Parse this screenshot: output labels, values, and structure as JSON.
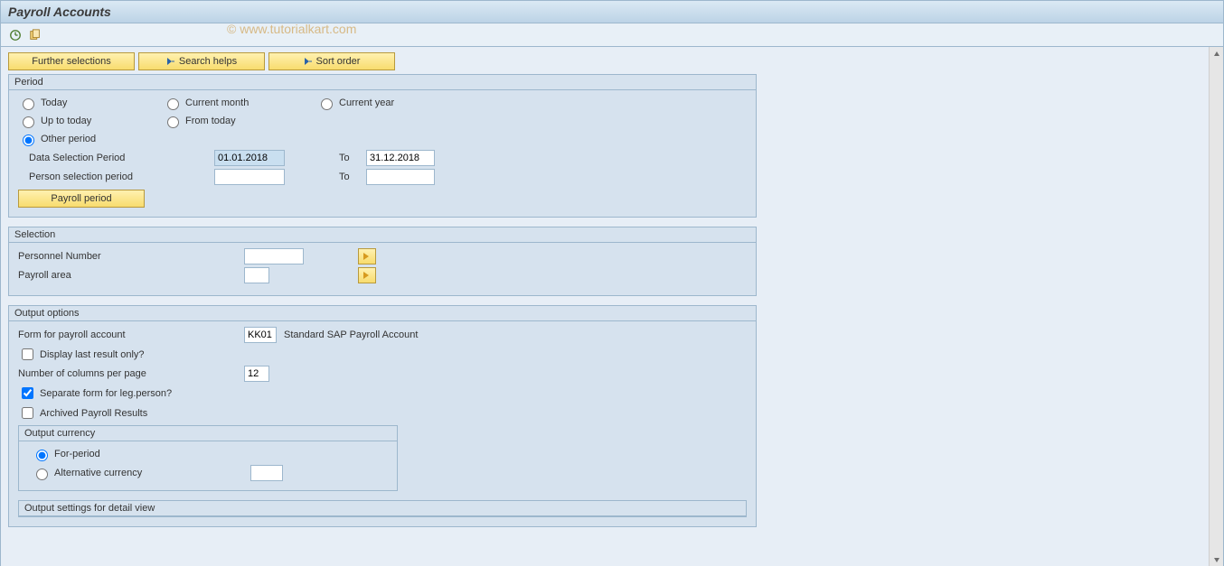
{
  "titlebar": {
    "title": "Payroll Accounts"
  },
  "watermark": "© www.tutorialkart.com",
  "action_buttons": {
    "further": "Further selections",
    "search": "Search helps",
    "sort": "Sort order"
  },
  "period": {
    "legend": "Period",
    "radios": {
      "today": "Today",
      "current_month": "Current month",
      "current_year": "Current year",
      "up_to_today": "Up to today",
      "from_today": "From today",
      "other": "Other period"
    },
    "data_sel_label": "Data Selection Period",
    "data_sel_from": "01.01.2018",
    "data_sel_to": "31.12.2018",
    "person_sel_label": "Person selection period",
    "person_sel_from": "",
    "person_sel_to": "",
    "to_label": "To",
    "payroll_period_btn": "Payroll period"
  },
  "selection": {
    "legend": "Selection",
    "personnel_number_label": "Personnel Number",
    "personnel_number": "",
    "payroll_area_label": "Payroll area",
    "payroll_area": ""
  },
  "output": {
    "legend": "Output options",
    "form_label": "Form for payroll account",
    "form_value": "KK01",
    "form_desc": "Standard SAP Payroll Account",
    "display_last_label": "Display last result only?",
    "cols_label": "Number of columns per page",
    "cols_value": "12",
    "sep_form_label": "Separate form for leg.person?",
    "archived_label": "Archived Payroll Results",
    "currency": {
      "legend": "Output currency",
      "for_period": "For-period",
      "alt": "Alternative currency",
      "alt_value": ""
    },
    "detail_legend": "Output settings for detail view"
  }
}
